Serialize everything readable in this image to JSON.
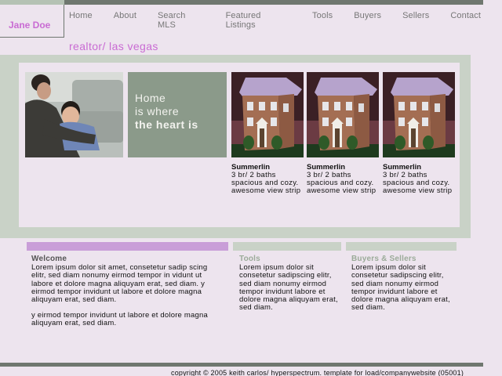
{
  "brand": {
    "name": "Jane Doe",
    "tagline": "realtor/ las vegas"
  },
  "colors": {
    "accent": "#c96bd3",
    "sage": "#8b9a8a",
    "panel": "#c9d2c7",
    "dark_bar": "#6f776f",
    "background": "#ede4ee"
  },
  "nav": [
    "Home",
    "About",
    "Search MLS",
    "Featured Listings",
    "Tools",
    "Buyers",
    "Sellers",
    "Contact"
  ],
  "quote": {
    "line1": "Home",
    "line2": "is where",
    "line3": "the heart is"
  },
  "listings": [
    {
      "title": "Summerlin",
      "desc": "3 br/ 2 baths spacious and cozy. awesome view strip"
    },
    {
      "title": "Summerlin",
      "desc": "3 br/ 2 baths spacious and cozy. awesome view strip"
    },
    {
      "title": "Summerlin",
      "desc": "3 br/ 2 baths spacious and cozy. awesome view strip"
    }
  ],
  "columns": {
    "welcome": {
      "heading": "Welcome",
      "body1": "Lorem ipsum dolor sit amet, consetetur sadip scing elitr, sed diam nonumy eirmod tempor in vidunt ut labore et dolore magna aliquyam erat, sed diam. y eirmod tempor invidunt ut labore et dolore magna aliquyam erat, sed diam.",
      "body2": "y eirmod tempor invidunt ut labore et dolore magna aliquyam erat, sed diam."
    },
    "tools": {
      "heading": "Tools",
      "body": "Lorem ipsum dolor sit consetetur sadipscing elitr, sed diam nonumy eirmod tempor invidunt labore et dolore magna aliquyam erat, sed diam."
    },
    "buyers": {
      "heading": "Buyers & Sellers",
      "body": "Lorem ipsum dolor sit consetetur sadipscing elitr, sed diam nonumy eirmod tempor invidunt labore et dolore magna aliquyam erat, sed diam."
    }
  },
  "footer": "copyright © 2005 keith carlos/ hyperspectrum. template for load/companywebsite (05001)",
  "images": {
    "photo": "mother-and-child-photo",
    "house": "house-photo"
  }
}
